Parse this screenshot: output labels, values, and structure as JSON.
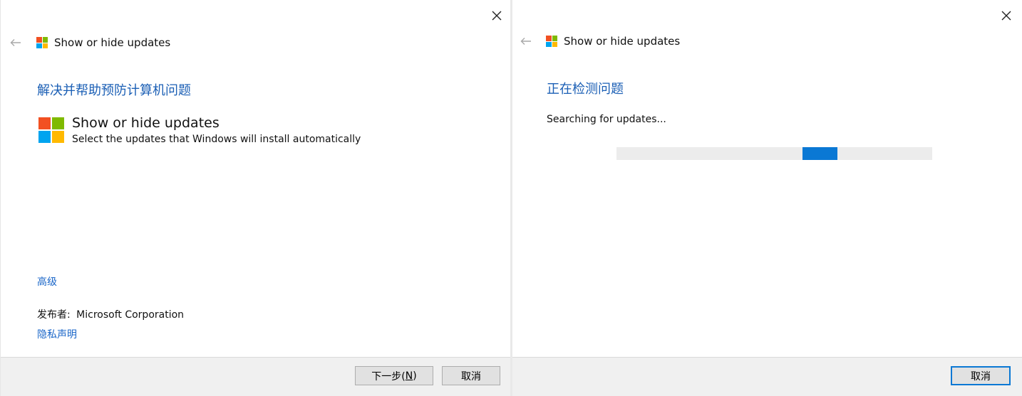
{
  "colors": {
    "link": "#1a66c8",
    "heading": "#1b5fb5",
    "progress": "#0a78d4",
    "logo_red": "#f25022",
    "logo_green": "#7fba00",
    "logo_blue": "#00a4ef",
    "logo_yellow": "#ffb900"
  },
  "left_dialog": {
    "title": "Show or hide updates",
    "heading": "解决并帮助预防计算机问题",
    "app": {
      "name": "Show or hide updates",
      "description": "Select the updates that Windows will install automatically"
    },
    "advanced_link": "高级",
    "publisher_label": "发布者:",
    "publisher_name": "Microsoft Corporation",
    "privacy_link": "隐私声明",
    "next_button": {
      "label": "下一步(",
      "accel": "N",
      "suffix": ")"
    },
    "cancel_button": "取消",
    "icons": [
      "back-arrow-icon",
      "close-icon",
      "windows-logo-icon"
    ]
  },
  "right_dialog": {
    "title": "Show or hide updates",
    "heading": "正在检测问题",
    "status": "Searching for updates...",
    "progress": {
      "type": "marquee",
      "chunk_position_fraction": 0.59,
      "chunk_width_fraction": 0.11
    },
    "cancel_button": "取消",
    "icons": [
      "back-arrow-icon",
      "close-icon",
      "windows-logo-icon"
    ]
  }
}
